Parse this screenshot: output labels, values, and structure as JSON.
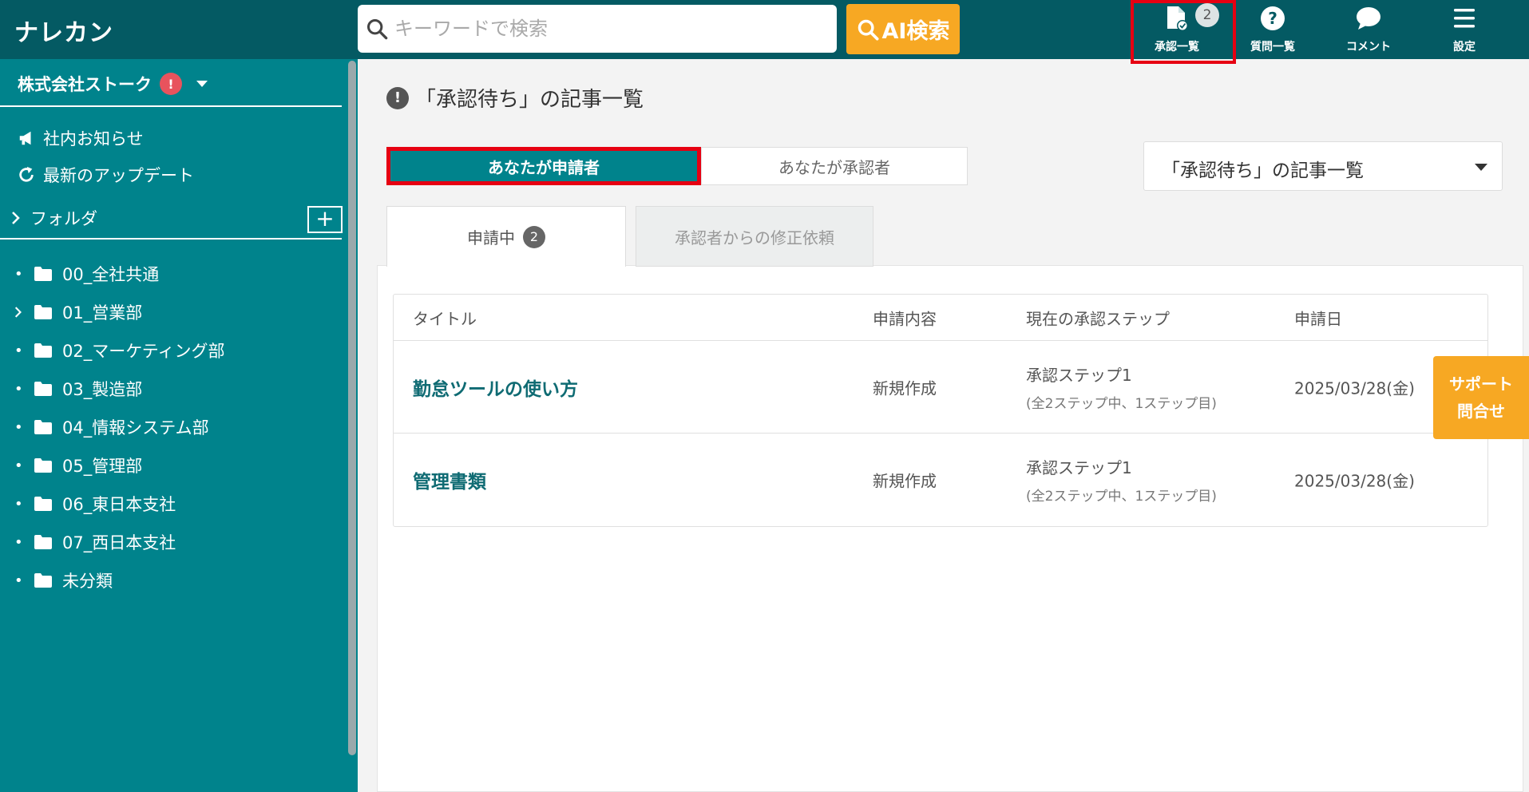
{
  "header": {
    "logo": "ナレカン",
    "search": {
      "placeholder": "キーワードで検索",
      "value": ""
    },
    "ai_search_label": "AI検索",
    "nav": [
      {
        "label": "承認一覧",
        "icon": "approval-document-icon",
        "badge": "2",
        "active": true
      },
      {
        "label": "質問一覧",
        "icon": "question-icon"
      },
      {
        "label": "コメント",
        "icon": "comment-icon"
      },
      {
        "label": "設定",
        "icon": "menu-icon"
      }
    ]
  },
  "sidebar": {
    "company": "株式会社ストーク",
    "company_alert": "!",
    "links": [
      {
        "label": "社内お知らせ",
        "icon": "megaphone-icon"
      },
      {
        "label": "最新のアップデート",
        "icon": "refresh-icon"
      }
    ],
    "folder_header": "フォルダ",
    "add_label": "+",
    "folders": [
      {
        "label": "00_全社共通",
        "expandable": false
      },
      {
        "label": "01_営業部",
        "expandable": true
      },
      {
        "label": "02_マーケティング部",
        "expandable": false
      },
      {
        "label": "03_製造部",
        "expandable": false
      },
      {
        "label": "04_情報システム部",
        "expandable": false
      },
      {
        "label": "05_管理部",
        "expandable": false
      },
      {
        "label": "06_東日本支社",
        "expandable": false
      },
      {
        "label": "07_西日本支社",
        "expandable": false
      },
      {
        "label": "未分類",
        "expandable": false
      }
    ]
  },
  "main": {
    "page_title": "「承認待ち」の記事一覧",
    "page_title_icon": "!",
    "segments": {
      "applicant": "あなたが申請者",
      "approver": "あなたが承認者"
    },
    "dropdown_value": "「承認待ち」の記事一覧",
    "tabs": {
      "pending": "申請中",
      "pending_count": "2",
      "revision": "承認者からの修正依頼"
    },
    "table": {
      "headers": [
        "タイトル",
        "申請内容",
        "現在の承認ステップ",
        "申請日"
      ],
      "rows": [
        {
          "title": "勤怠ツールの使い方",
          "content": "新規作成",
          "step": "承認ステップ1",
          "step_detail": "(全2ステップ中、1ステップ目)",
          "date": "2025/03/28(金)"
        },
        {
          "title": "管理書類",
          "content": "新規作成",
          "step": "承認ステップ1",
          "step_detail": "(全2ステップ中、1ステップ目)",
          "date": "2025/03/28(金)"
        }
      ]
    }
  },
  "support": {
    "line1": "サポート",
    "line2": "問合せ"
  },
  "colors": {
    "header": "#045a63",
    "sidebar": "#00838c",
    "accent": "#f7a823",
    "highlight": "#e60012"
  }
}
